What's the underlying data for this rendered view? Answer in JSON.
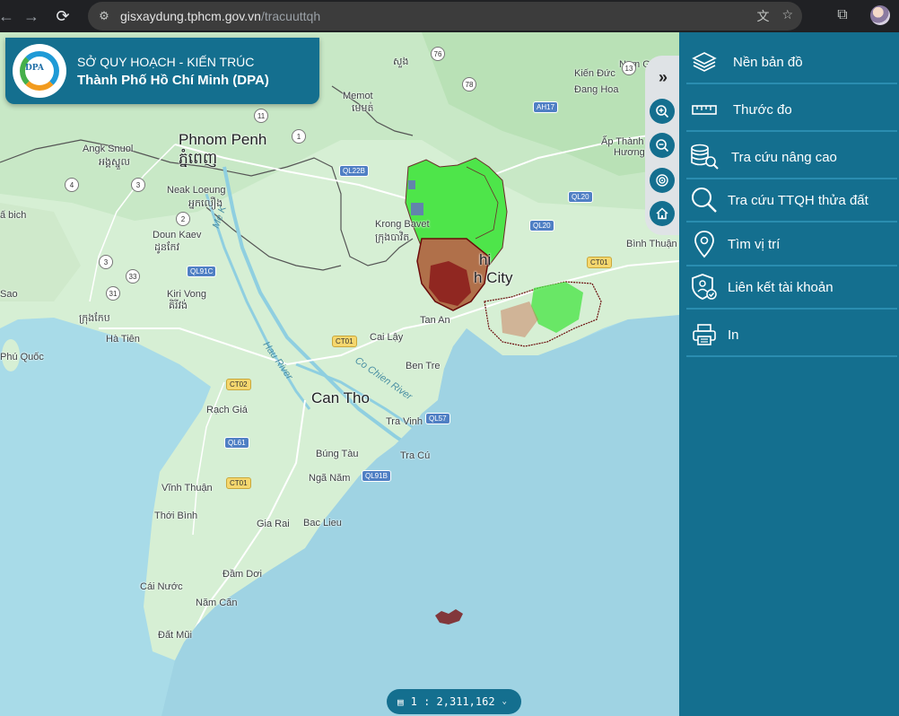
{
  "browser": {
    "back_icon": "arrow-left-icon",
    "forward_icon": "arrow-right-icon",
    "reload_icon": "reload-icon",
    "url_host": "gisxaydung.tphcm.gov.vn",
    "url_path": "/tracuuttqh"
  },
  "org": {
    "line1": "SỞ QUY HOẠCH - KIẾN TRÚC",
    "line2": "Thành Phố Hồ Chí Minh (DPA)",
    "logo_text": "DPA"
  },
  "menu": [
    {
      "label": "Nền bản đồ",
      "icon": "layers-icon"
    },
    {
      "label": "Thước đo",
      "icon": "ruler-icon"
    },
    {
      "label": "Tra cứu nâng cao",
      "icon": "database-search-icon"
    },
    {
      "label": "Tra cứu TTQH thửa đất",
      "icon": "search-icon"
    },
    {
      "label": "Tìm vị trí",
      "icon": "location-pin-icon"
    },
    {
      "label": "Liên kết tài khoản",
      "icon": "account-shield-icon"
    },
    {
      "label": "In",
      "icon": "printer-icon"
    }
  ],
  "scale": {
    "text": "1 : 2,311,162"
  },
  "map_labels": {
    "phnom_penh": "Phnom Penh",
    "phnom_penh_km": "ភ្នំពេញ",
    "can_tho": "Can Tho",
    "hcm_city": "hi",
    "hcm_city2": "h City",
    "angk_snuol": "Angk Snuol",
    "angk_snuol_km": "អង្គស្នួល",
    "neak_loeung": "Neak Loeung",
    "neak_loeung_km": "អ្នកលឿង",
    "doun_kaev": "Doun Kaev",
    "doun_kaev_km": "ដូនកែវ",
    "kiri_vong": "Kiri Vong",
    "kiri_vong_km": "គិរីវង់",
    "krong_kaep": "ក្រុងកែប",
    "krong_bavet": "Krong Bavet",
    "krong_bavet_km": "ក្រុងបាវិត",
    "memot": "Memot",
    "memot_km": "មេមត់",
    "suong": "សួង",
    "kien_duc": "Kiến Đức",
    "dang_hoa": "Đang Hoa",
    "nam_g": "Nam G",
    "ap_thanh": "Ấp Thành",
    "huong": "Hương",
    "binh_thuan": "Bình Thuận",
    "tan_an": "Tan An",
    "cai_lay": "Cai Lậy",
    "ben_tre": "Ben Tre",
    "tra_vinh": "Tra Vinh",
    "tra_cu": "Tra Cú",
    "ha_tien": "Hà Tiên",
    "phu_quoc": "Phú Quốc",
    "rach_gia": "Rạch Giá",
    "vinh_thuan": "Vĩnh Thuận",
    "thoi_binh": "Thới Bình",
    "gia_rai": "Gia Rai",
    "bac_lieu": "Bac Lieu",
    "nga_nam": "Ngã Năm",
    "bung_tau": "Búng Tàu",
    "dam_doi": "Đầm Dơi",
    "cai_nuoc": "Cái Nước",
    "nam_can": "Năm Căn",
    "dat_mui": "Đất Mũi",
    "saco": "Sao",
    "bich": "ấ bich",
    "hau_river": "Hau River",
    "co_chien_river": "Co Chien River",
    "me_kong": "Me K",
    "road_ql22b": "QL22B",
    "road_ql91c": "QL91C",
    "road_ql61": "QL61",
    "road_ql57": "QL57",
    "road_ql91b": "QL91B",
    "road_ql20a": "QL20",
    "road_ql20b": "QL20",
    "road_ah17": "AH17",
    "road_ct01a": "CT01",
    "road_ct01b": "CT01",
    "road_ct01c": "CT01",
    "road_ct02": "CT02",
    "shield_76": "76",
    "shield_78": "78",
    "shield_11": "11",
    "shield_1": "1",
    "shield_4": "4",
    "shield_3": "3",
    "shield_2": "2",
    "shield_31": "31",
    "shield_33": "33",
    "shield_13": "13",
    "shield_7": "7"
  }
}
